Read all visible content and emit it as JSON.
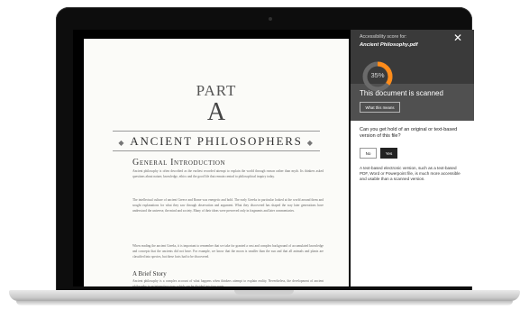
{
  "document": {
    "part_label": "PART",
    "part_letter": "A",
    "title": "ANCIENT PHILOSOPHERS",
    "section_heading": "General Introduction",
    "paragraphs": [
      "Ancient philosophy is often described as the earliest recorded attempt to explain the world through reason rather than myth. Its thinkers asked questions about nature, knowledge, ethics and the good life that remain central to philosophical inquiry today.",
      "The intellectual culture of ancient Greece and Rome was energetic and bold. The early Greeks in particular looked at the world around them and sought explanations for what they saw through observation and argument. What they discovered has shaped the way later generations have understood the universe, the mind and society. Many of their ideas were preserved only in fragments and later commentaries.",
      "When reading the ancient Greeks, it is important to remember that we take for granted a vast and complex background of accumulated knowledge and concepts that the ancients did not have. For example, we know that the moon is smaller than the sun and that all animals and plants are classified into species, but these facts had to be discovered."
    ],
    "subheading": "A Brief Story",
    "closing_paragraph": "Ancient philosophy is a complex account of what happens when thinkers attempt to explain reality. Nevertheless, the development of ancient philosophy is an interesting story, which can be divided into four parts."
  },
  "panel": {
    "score_label": "Accessibility score for:",
    "file_name": "Ancient Philosophy.pdf",
    "score_percent": 35,
    "score_text": "35%",
    "status_title": "This document is scanned",
    "what_button": "What this means",
    "question": "Can you get hold of an original or text-based version of this file?",
    "no_button": "No",
    "yes_button": "Yes",
    "help_text": "A text-based electronic version, such as a text-based PDF, Word or Powerpoint file, is much more accessible and usable than a scanned version.",
    "close_icon": "close-icon",
    "colors": {
      "gauge": "#ff8c1a",
      "gauge_track": "#6a6a6a",
      "panel_dark": "#3a3a3a",
      "status_band": "#505050"
    }
  }
}
